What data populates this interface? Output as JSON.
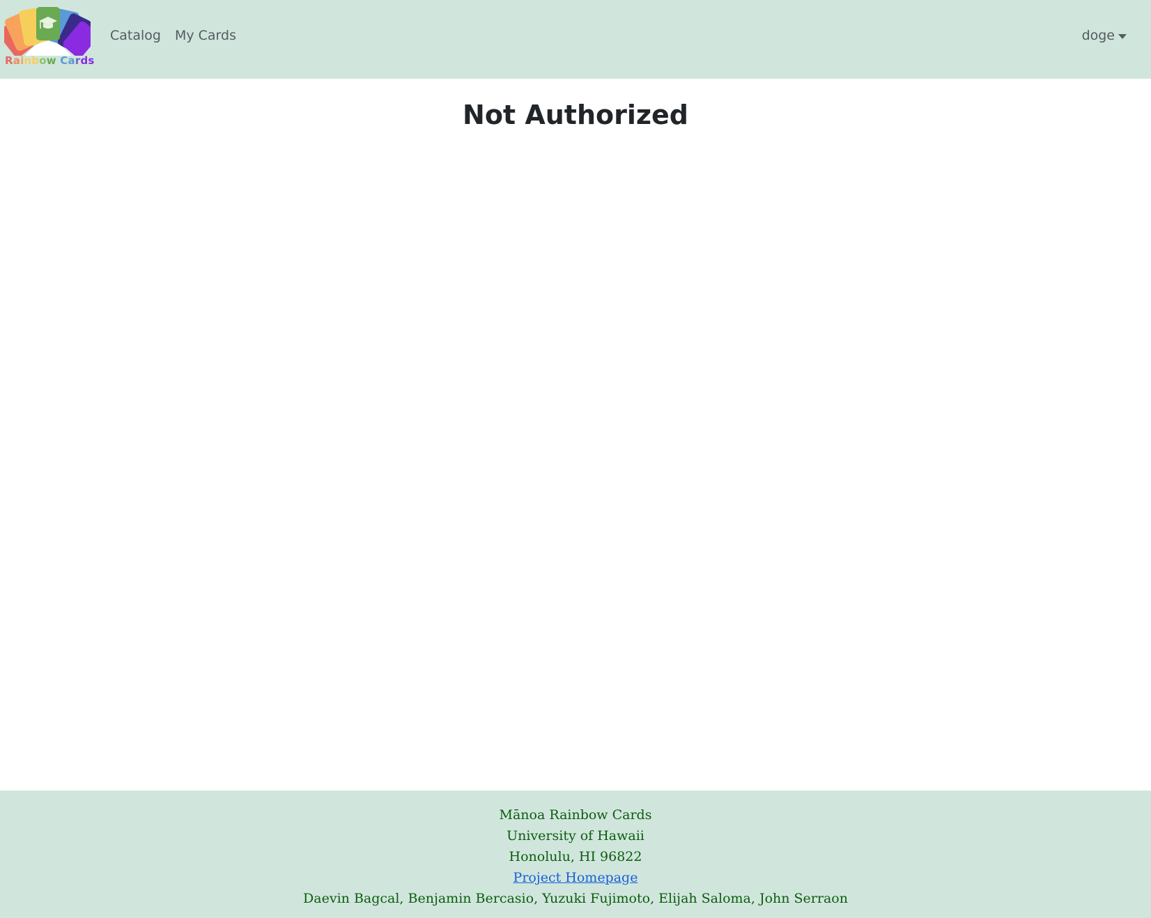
{
  "brand": {
    "logo_letters": [
      "R",
      "a",
      "i",
      "n",
      "b",
      "o",
      "w",
      " ",
      "C",
      "a",
      "r",
      "d",
      "s"
    ],
    "logo_colors": [
      "#e8685f",
      "#f7a35c",
      "#f6cf5b",
      "#f6cf5b",
      "#8ec26a",
      "#5a9bd5",
      "#5a9bd5",
      "",
      "#5a9bd5",
      "#7a5ec8",
      "#7a3fd0",
      "#8a2be2",
      "#8a2be2"
    ],
    "icon": "graduation-cap-icon"
  },
  "nav": {
    "catalog_label": "Catalog",
    "my_cards_label": "My Cards",
    "user_label": "doge"
  },
  "main": {
    "title": "Not Authorized"
  },
  "footer": {
    "line1": "Mānoa Rainbow Cards",
    "line2": "University of Hawaii",
    "line3": "Honolulu, HI 96822",
    "link_label": "Project Homepage",
    "authors": "Daevin Bagcal, Benjamin Bercasio, Yuzuki Fujimoto, Elijah Saloma, John Serraon"
  },
  "colors": {
    "navbar_bg": "#d0e6dd",
    "footer_text": "#0d5c0d",
    "link": "#1a5fd8",
    "title": "#212529"
  }
}
